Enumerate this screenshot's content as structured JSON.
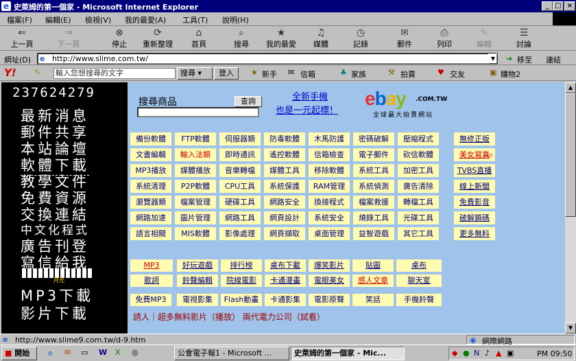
{
  "window": {
    "title": "史萊姆的第一個家 - Microsoft Internet Explorer"
  },
  "menu": [
    "檔案(F)",
    "編輯(E)",
    "檢視(V)",
    "我的最愛(A)",
    "工具(T)",
    "說明(H)"
  ],
  "toolbar": [
    "上一頁",
    "下一頁",
    "停止",
    "重新整理",
    "首頁",
    "搜尋",
    "我的最愛",
    "媒體",
    "記錄",
    "郵件",
    "列印",
    "編輯",
    "討論"
  ],
  "address": {
    "label": "網址(D)",
    "url": "http://www.slime.com.tw/",
    "go": "移至",
    "links": "連結"
  },
  "yahoo": {
    "search_placeholder": "輸入您想搜尋的文字",
    "search_btn": "搜尋",
    "login_btn": "登入",
    "items": [
      "新手",
      "信箱",
      "家族",
      "拍賣",
      "交友",
      "購物2"
    ]
  },
  "left": {
    "counter": "237624279",
    "rows": [
      "最新消息",
      "郵件共享",
      "本站論壇",
      "軟體下載",
      "教學文件",
      "免費資源",
      "交換連結",
      "中文化程式",
      "廣告刊登",
      "寫信給我",
      "月光",
      "MP3下載",
      "影片下載"
    ]
  },
  "main": {
    "search_label": "搜尋商品",
    "search_btn": "查詢",
    "promo1": "全新手機",
    "promo2": "也是一元起標！",
    "ebay_logo": "ebay",
    "ebay_suffix": ".COM.TW",
    "ebay_tagline": "全球最大拍賣網站",
    "grid": [
      [
        "備份軟體",
        "FTP軟體",
        "伺服器類",
        "防毒軟體",
        "木馬防護",
        "密碼破解",
        "壓縮程式"
      ],
      [
        "文書編輯",
        "輸入法類",
        "即時通訊",
        "遙控軟體",
        "信箱檢查",
        "電子郵件",
        "砍信軟體"
      ],
      [
        "MP3播放",
        "媒體播放",
        "音樂轉檔",
        "媒體工具",
        "移除軟體",
        "系統工具",
        "加密工具"
      ],
      [
        "系統清理",
        "P2P軟體",
        "CPU工具",
        "系統保護",
        "RAM管理",
        "系統偵測",
        "廣告清除"
      ],
      [
        "瀏覽器類",
        "檔案管理",
        "硬碟工具",
        "網路安全",
        "換接程式",
        "檔案救援",
        "轉檔工具"
      ],
      [
        "網路加速",
        "圖片管理",
        "網路工具",
        "網頁設計",
        "系統安全",
        "燒錄工具",
        "光碟工具"
      ],
      [
        "語言相關",
        "MIS軟體",
        "影像處理",
        "網頁擷取",
        "桌面管理",
        "益智遊戲",
        "其它工具"
      ]
    ],
    "side": [
      "無修正版",
      "美女寫真",
      "TVBS直播",
      "線上新聞",
      "免費影音",
      "破解鎖碼",
      "更多無料"
    ],
    "side_badge": "HOT",
    "row2": [
      [
        "MP3",
        "好玩遊戲",
        "排行榜",
        "桌布下載",
        "爆笑影片",
        "貼圖",
        "桌布"
      ],
      [
        "歌詞",
        "鈴聲編輯",
        "院線電影",
        "卡通漫畫",
        "電眼美女",
        "感人文章",
        "聊天室"
      ]
    ],
    "row3": [
      "免費MP3",
      "電視影集",
      "Flash動畫",
      "卡通影集",
      "電影原聲",
      "笑話",
      "手機鈴聲"
    ],
    "footer": "誘人｜超多無料影片（播放） 兩代電力公司（試看）"
  },
  "status": {
    "url": "http://www.slime9.com.tw/d-9.htm",
    "zone": "網際網路"
  },
  "taskbar": {
    "start": "開始",
    "tasks": [
      "公會電子報1 - Microsoft ...",
      "史萊姆的第一個家 - Mic..."
    ],
    "time": "PM 09:50"
  }
}
